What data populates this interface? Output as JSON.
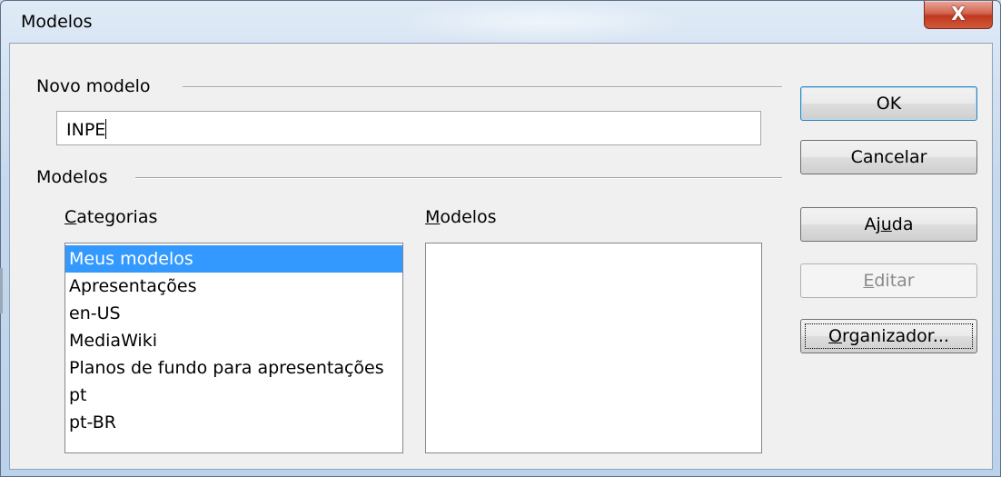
{
  "window": {
    "title": "Modelos",
    "close_label": "X"
  },
  "new_template": {
    "group_label": "Novo modelo",
    "name_value": "INPE"
  },
  "templates": {
    "group_label": "Modelos",
    "categories_label": "Categorias",
    "categories_mnemonic": "C",
    "categories_rest": "ategorias",
    "models_label": "Modelos",
    "models_mnemonic": "M",
    "models_rest": "odelos",
    "categories": [
      {
        "label": "Meus modelos",
        "selected": true
      },
      {
        "label": "Apresentações",
        "selected": false
      },
      {
        "label": "en-US",
        "selected": false
      },
      {
        "label": "MediaWiki",
        "selected": false
      },
      {
        "label": "Planos de fundo para apresentações",
        "selected": false
      },
      {
        "label": "pt",
        "selected": false
      },
      {
        "label": "pt-BR",
        "selected": false
      }
    ],
    "models": []
  },
  "buttons": {
    "ok": "OK",
    "cancel": "Cancelar",
    "help_pre": "Aj",
    "help_mnemonic": "u",
    "help_post": "da",
    "edit_mnemonic": "E",
    "edit_rest": "ditar",
    "organizer_mnemonic": "O",
    "organizer_rest": "rganizador..."
  },
  "colors": {
    "selection": "#3399ff",
    "close_button": "#c9452f",
    "dialog_bg": "#f0f0f0"
  }
}
